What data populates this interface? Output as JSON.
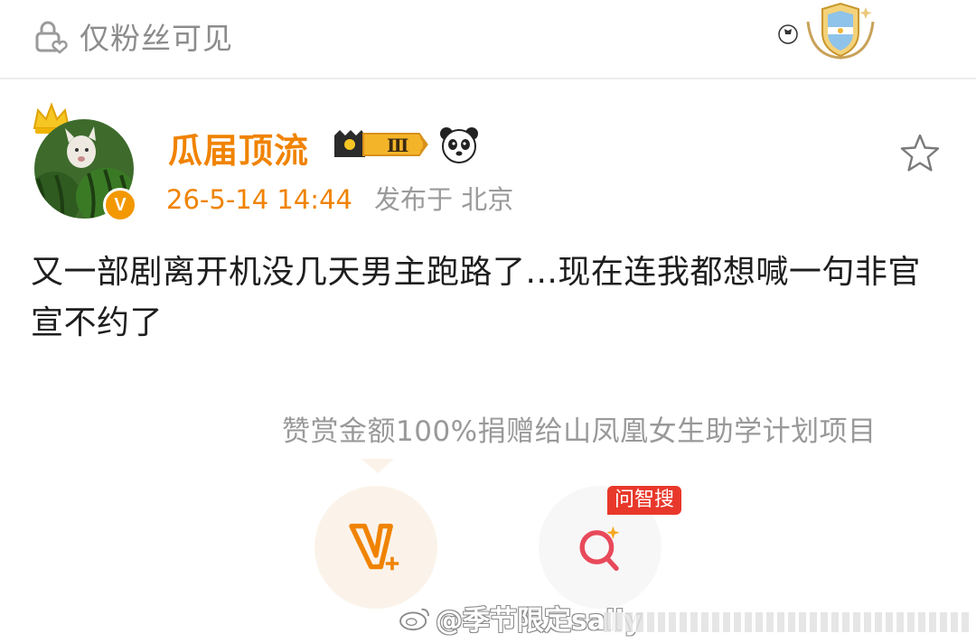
{
  "header": {
    "visibility_label": "仅粉丝可见",
    "lock_icon": "lock-heart-icon",
    "medal_icon": "team-medal-icon"
  },
  "post": {
    "username": "瓜届顶流",
    "vip_level_text": "Ⅲ",
    "timestamp": "26-5-14 14:44",
    "location": "发布于 北京",
    "avatar_badge": "V",
    "text": "又一部剧离开机没几天男主跑路了...现在连我都想喊一句非官宣不约了",
    "favorite_icon": "star-outline-icon"
  },
  "reward": {
    "note": "赞赏金额100%捐赠给山凤凰女生助学计划项目",
    "reward_icon": "v-plus-icon",
    "search_tag": "问智搜",
    "search_icon": "ai-search-icon"
  },
  "watermark": {
    "text": "@季节限定sally"
  },
  "colors": {
    "accent": "#f08300",
    "muted": "#9a9a9a",
    "tag_red": "#e8382b"
  }
}
